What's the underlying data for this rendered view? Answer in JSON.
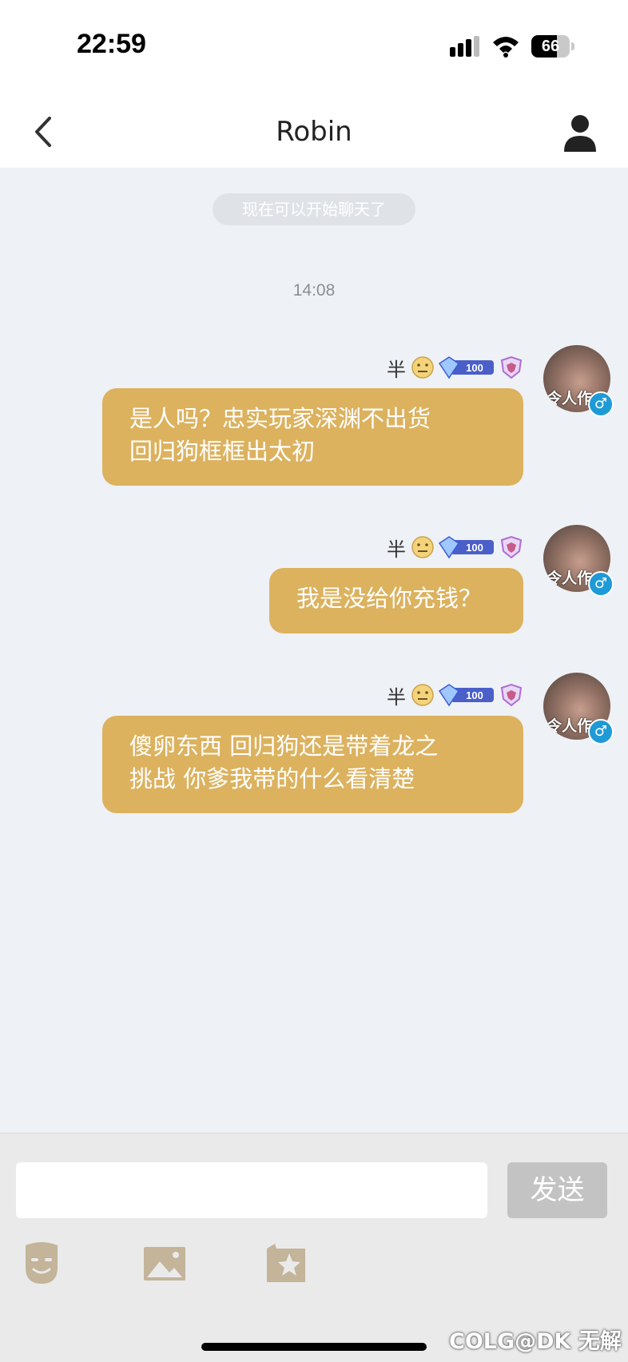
{
  "status_bar": {
    "time": "22:59",
    "battery_level": "66",
    "battery_percent": 66
  },
  "header": {
    "title": "Robin",
    "back_icon": "chevron-left-icon",
    "profile_icon": "person-icon"
  },
  "chat": {
    "system_notice": "现在可以开始聊天了",
    "timestamp": "14:08",
    "messages": [
      {
        "sender_name": "半",
        "avatar_caption": "令人作",
        "gender_symbol": "♂",
        "lines": [
          "是人吗？忠实玩家深渊不出货",
          "回归狗框框出太初"
        ]
      },
      {
        "sender_name": "半",
        "avatar_caption": "令人作",
        "gender_symbol": "♂",
        "lines": [
          "我是没给你充钱？"
        ]
      },
      {
        "sender_name": "半",
        "avatar_caption": "令人作",
        "gender_symbol": "♂",
        "lines": [
          "傻卵东西 回归狗还是带着龙之",
          "挑战 你爹我带的什么看清楚"
        ]
      }
    ],
    "level_badge_text": "100"
  },
  "input_bar": {
    "placeholder": "",
    "send_label": "发送",
    "tools": [
      "sticker-face-icon",
      "image-icon",
      "media-star-icon"
    ]
  },
  "watermark": "COLG@DK 无解",
  "colors": {
    "bubble": "#dcb25f",
    "background": "#eef1f5",
    "send_button": "#c3c3c3",
    "gender_badge": "#1e9ad6"
  }
}
